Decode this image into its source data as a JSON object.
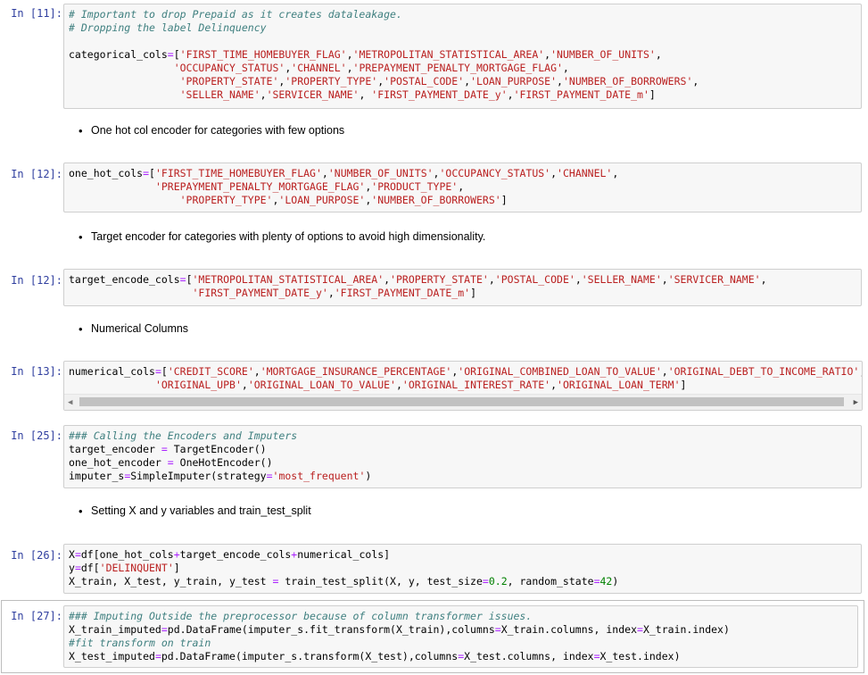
{
  "cells": [
    {
      "prompt": "In [11]:"
    },
    {
      "prompt": "In [12]:"
    },
    {
      "prompt": "In [12]:"
    },
    {
      "prompt": "In [13]:"
    },
    {
      "prompt": "In [25]:"
    },
    {
      "prompt": "In [26]:"
    },
    {
      "prompt": "In [27]:"
    }
  ],
  "markdown": [
    "One hot col encoder for categories with few options",
    "Target encoder for categories with plenty of options to avoid high dimensionality.",
    "Numerical Columns",
    "Setting X and y variables and train_test_split"
  ],
  "tokens": {
    "c11_1": "# Important to drop Prepaid as it creates dataleakage.",
    "c11_2": "# Dropping the label Delinquency",
    "cat_var": "categorical_cols",
    "s_first_time": "'FIRST_TIME_HOMEBUYER_FLAG'",
    "s_msa": "'METROPOLITAN_STATISTICAL_AREA'",
    "s_units": "'NUMBER_OF_UNITS'",
    "s_occ": "'OCCUPANCY_STATUS'",
    "s_channel": "'CHANNEL'",
    "s_ppm": "'PREPAYMENT_PENALTY_MORTGAGE_FLAG'",
    "s_state": "'PROPERTY_STATE'",
    "s_ptype": "'PROPERTY_TYPE'",
    "s_postal": "'POSTAL_CODE'",
    "s_purpose": "'LOAN_PURPOSE'",
    "s_borrowers": "'NUMBER_OF_BORROWERS'",
    "s_seller": "'SELLER_NAME'",
    "s_servicer": "'SERVICER_NAME'",
    "s_fpd_y": "'FIRST_PAYMENT_DATE_y'",
    "s_fpd_m": "'FIRST_PAYMENT_DATE_m'",
    "s_product": "'PRODUCT_TYPE'",
    "oh_var": "one_hot_cols",
    "te_var": "target_encode_cols",
    "num_var": "numerical_cols",
    "s_credit": "'CREDIT_SCORE'",
    "s_mip": "'MORTGAGE_INSURANCE_PERCENTAGE'",
    "s_ocltv": "'ORIGINAL_COMBINED_LOAN_TO_VALUE'",
    "s_odti": "'ORIGINAL_DEBT_TO_INCOME_RATIO'",
    "s_oupb": "'ORIGINAL_UPB'",
    "s_oltv": "'ORIGINAL_LOAN_TO_VALUE'",
    "s_oir": "'ORIGINAL_INTEREST_RATE'",
    "s_olt": "'ORIGINAL_LOAN_TERM'",
    "c25": "### Calling the Encoders and Imputers",
    "te_assign": "target_encoder ",
    "te_ctor": " TargetEncoder()",
    "oh_assign": "one_hot_encoder ",
    "oh_ctor": " OneHotEncoder()",
    "imp_assign": "imputer_s",
    "imp_ctor": "SimpleImputer(strategy",
    "s_most": "'most_frequent'",
    "x_assign": "X",
    "x_expr": "df[one_hot_cols",
    "x_te": "target_encode_cols",
    "x_num": "numerical_cols]",
    "y_assign": "y",
    "y_expr": "df[",
    "s_delinq": "'DELINQUENT'",
    "split_lhs": "X_train, X_test, y_train, y_test ",
    "split_rhs": " train_test_split(X, y, test_size",
    "n_02": "0.2",
    "split_rs": ", random_state",
    "n_42": "42",
    "c27_1": "### Imputing Outside the preprocessor because of column transformer issues.",
    "xtr_lhs": "X_train_imputed",
    "xtr_mid": "pd.DataFrame(imputer_s.fit_transform(X_train),columns",
    "xtr_cols": "X_train.columns, index",
    "xtr_idx": "X_train.index)",
    "c27_2": "#fit transform on train",
    "xte_lhs": "X_test_imputed",
    "xte_mid": "pd.DataFrame(imputer_s.transform(X_test),columns",
    "xte_cols": "X_test.columns, index",
    "xte_idx": "X_test.index)"
  },
  "icons": {
    "scroll_left": "◀",
    "scroll_right": "▶"
  }
}
